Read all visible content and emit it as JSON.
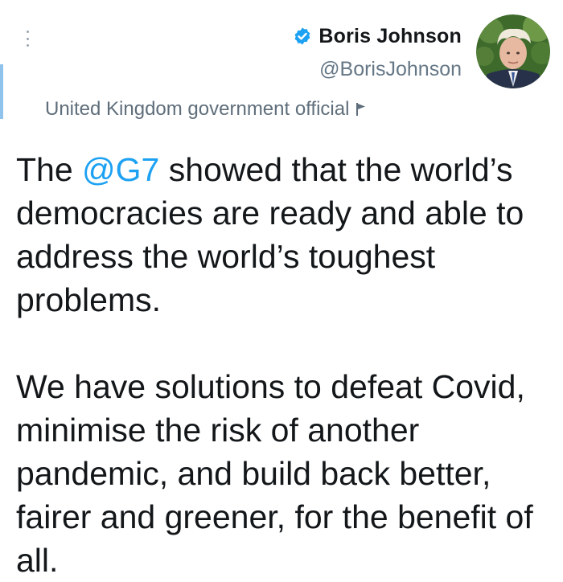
{
  "author": {
    "display_name": "Boris Johnson",
    "handle": "@BorisJohnson",
    "verified": true,
    "avatar_icon": "user-avatar-photo",
    "label": "United Kingdom government official",
    "label_icon": "flag-icon"
  },
  "tweet": {
    "paragraph1": {
      "before_mention": "The ",
      "mention": "@G7",
      "after_mention": " showed that the world’s democracies are ready and able to address the world’s toughest problems."
    },
    "paragraph2": "We have solutions to defeat Covid, minimise the risk of another pandemic, and build back better, fairer and greener, for the benefit of all."
  },
  "colors": {
    "link": "#1da1f2",
    "text": "#14171a",
    "secondary": "#657786",
    "verified_badge": "#1da1f2"
  },
  "icons": {
    "more": "more-vertical-icon",
    "verified": "verified-badge-icon"
  }
}
